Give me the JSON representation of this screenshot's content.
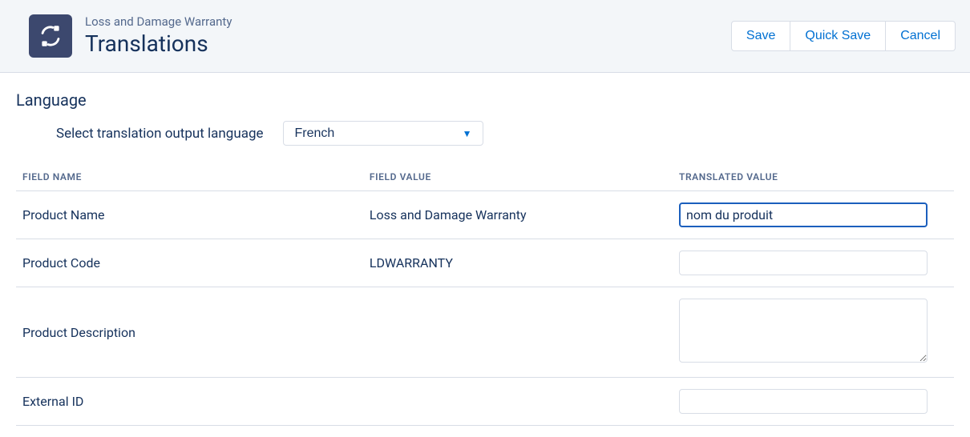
{
  "header": {
    "breadcrumb": "Loss and Damage Warranty",
    "title": "Translations",
    "buttons": {
      "save": "Save",
      "quick_save": "Quick Save",
      "cancel": "Cancel"
    }
  },
  "section": {
    "heading": "Language",
    "select_label": "Select translation output language",
    "language_selected": "French"
  },
  "table": {
    "columns": {
      "field_name": "FIELD NAME",
      "field_value": "FIELD VALUE",
      "translated_value": "TRANSLATED VALUE"
    },
    "rows": [
      {
        "field_name": "Product Name",
        "field_value": "Loss and Damage Warranty",
        "translated_value": "nom du produit",
        "input_type": "text",
        "focused": true
      },
      {
        "field_name": "Product Code",
        "field_value": "LDWARRANTY",
        "translated_value": "",
        "input_type": "text",
        "focused": false
      },
      {
        "field_name": "Product Description",
        "field_value": "",
        "translated_value": "",
        "input_type": "textarea",
        "focused": false
      },
      {
        "field_name": "External ID",
        "field_value": "",
        "translated_value": "",
        "input_type": "text",
        "focused": false
      }
    ]
  }
}
